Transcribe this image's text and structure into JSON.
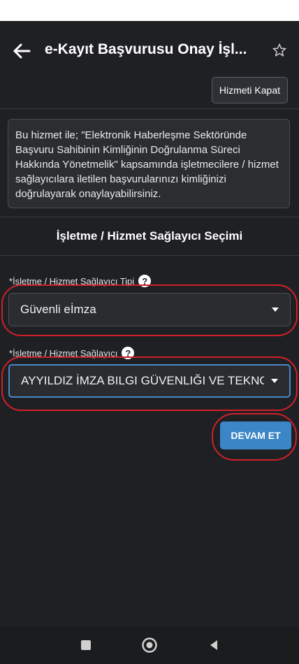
{
  "header": {
    "title": "e-Kayıt Başvurusu Onay İşl...",
    "back_icon": "arrow-left-icon",
    "favorite_icon": "star-outline-icon"
  },
  "toolbar": {
    "close_service_label": "Hizmeti Kapat"
  },
  "info_text": "Bu hizmet ile; \"Elektronik Haberleşme Sektöründe Başvuru Sahibinin Kimliğinin Doğrulanma Süreci Hakkında Yönetmelik\" kapsamında işletmecilere / hizmet sağlayıcılara iletilen başvurularınızı kimliğinizi doğrulayarak onaylayabilirsiniz.",
  "section_title": "İşletme / Hizmet Sağlayıcı Seçimi",
  "fields": {
    "provider_type": {
      "label": "*İşletme / Hizmet Sağlayıcı Tipi",
      "help": "?",
      "value": "Güvenli eİmza"
    },
    "provider": {
      "label": "*İşletme / Hizmet Sağlayıcı",
      "help": "?",
      "value": "AYYILDIZ İMZA BILGI GÜVENLIĞI VE TEKNO"
    }
  },
  "actions": {
    "continue_label": "DEVAM ET"
  },
  "colors": {
    "background": "#1f2023",
    "primary_button": "#3c86c8",
    "focus_border": "#4a88c7",
    "annotation_ring": "#d0202a"
  },
  "system_nav": {
    "icons": [
      "square-recents-icon",
      "circle-home-icon",
      "triangle-back-icon"
    ]
  }
}
